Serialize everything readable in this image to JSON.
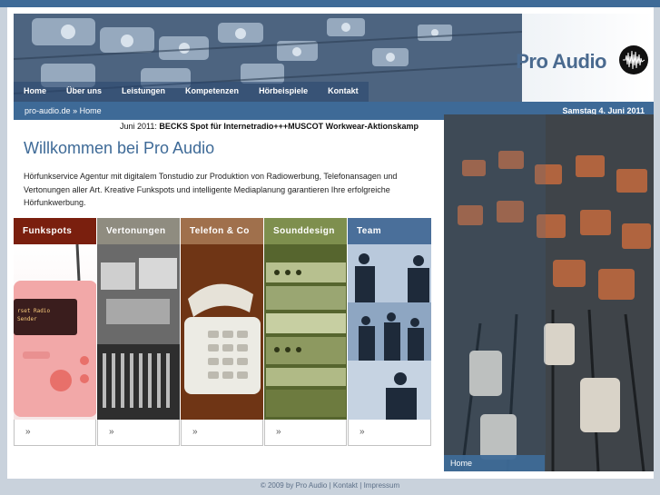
{
  "header": {
    "logo_text": "Pro Audio"
  },
  "nav": {
    "items": [
      {
        "label": "Home"
      },
      {
        "label": "Über uns"
      },
      {
        "label": "Leistungen"
      },
      {
        "label": "Kompetenzen"
      },
      {
        "label": "Hörbeispiele"
      },
      {
        "label": "Kontakt"
      }
    ]
  },
  "breadcrumb": {
    "site": "pro-audio.de",
    "separator": "»",
    "current": "Home"
  },
  "date": "Samstag 4. Juni 2011",
  "ticker": {
    "prefix": "Juni 2011: ",
    "text": "BECKS Spot für Internetradio+++MUSCOT Workwear-Aktionskamp"
  },
  "main": {
    "title": "Willkommen bei Pro Audio",
    "intro": "Hörfunkservice Agentur mit digitalem Tonstudio zur Produktion von Radiowerbung, Telefonansagen und Vertonungen aller Art. Kreative Funkspots und intelligente Mediaplanung garantieren Ihre erfolgreiche Hörfunkwerbung."
  },
  "tiles": [
    {
      "label": "Funkspots",
      "more": "»",
      "color": "#7a1f0e"
    },
    {
      "label": "Vertonungen",
      "more": "»",
      "color": "#8f8c80"
    },
    {
      "label": "Telefon & Co",
      "more": "»",
      "color": "#a0704c"
    },
    {
      "label": "Sounddesign",
      "more": "»",
      "color": "#7e8f4e"
    },
    {
      "label": "Team",
      "more": "»",
      "color": "#4a6f9a"
    }
  ],
  "photo": {
    "caption": "Home"
  },
  "footer": {
    "copyright": "© 2009 by Pro Audio",
    "sep": "|",
    "kontakt": "Kontakt",
    "impressum": "Impressum"
  },
  "colors": {
    "brand_blue": "#3e6a97",
    "background": "#c9d2dc"
  }
}
